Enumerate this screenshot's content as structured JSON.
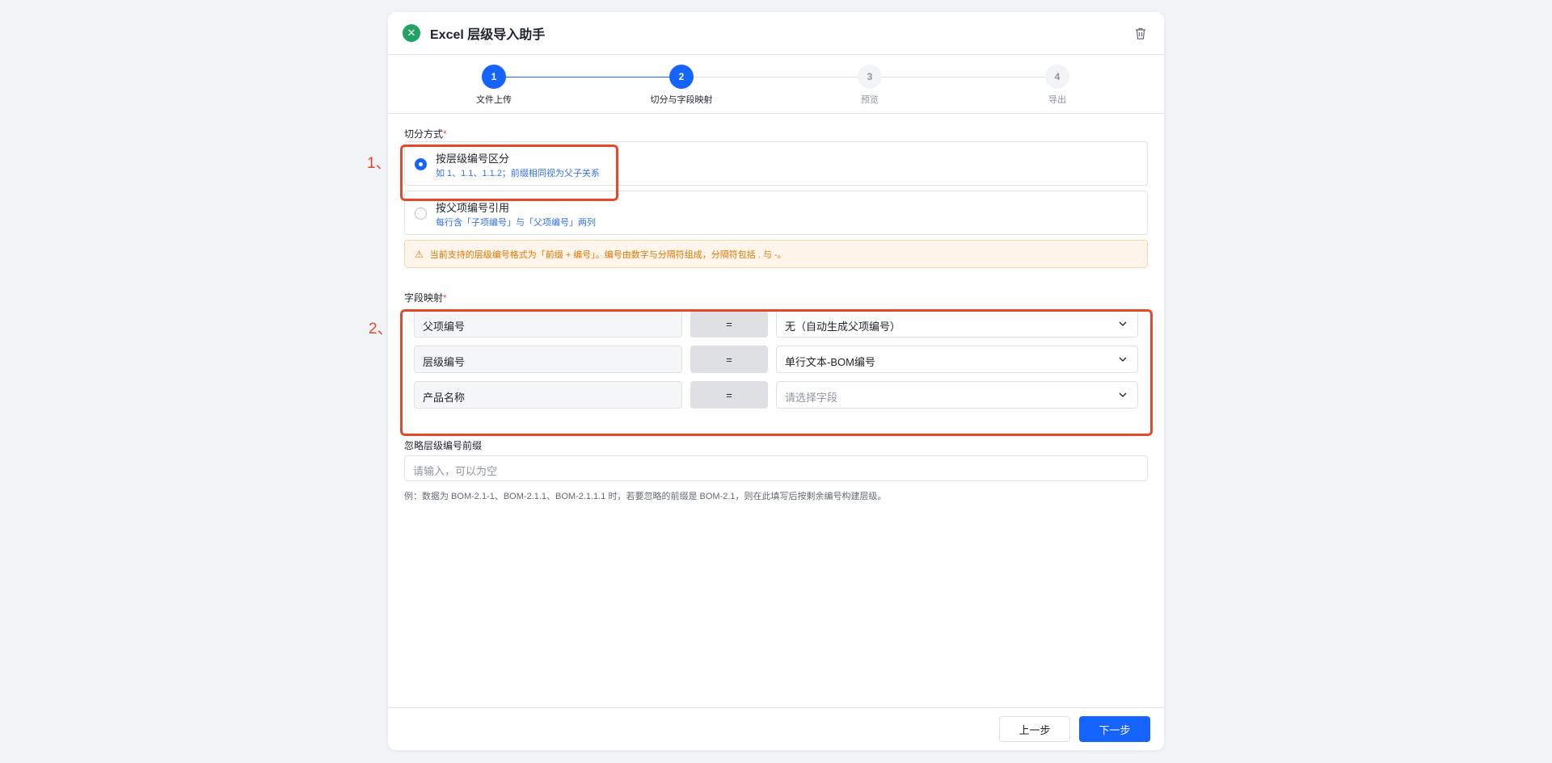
{
  "header": {
    "app_icon": "excel-icon",
    "title": "Excel 层级导入助手",
    "delete_icon": "trash-icon"
  },
  "steps": [
    {
      "number": "1",
      "label": "文件上传",
      "state": "done"
    },
    {
      "number": "2",
      "label": "切分与字段映射",
      "state": "active"
    },
    {
      "number": "3",
      "label": "预览",
      "state": "pending"
    },
    {
      "number": "4",
      "label": "导出",
      "state": "pending"
    }
  ],
  "split": {
    "label": "切分方式",
    "required_mark": "*",
    "options": [
      {
        "title": "按层级编号区分",
        "desc": "如 1、1.1、1.1.2；前缀相同视为父子关系",
        "checked": true
      },
      {
        "title": "按父项编号引用",
        "desc": "每行含「子项编号」与「父项编号」两列",
        "checked": false
      }
    ]
  },
  "warning": {
    "icon": "warning-icon",
    "text": "当前支持的层级编号格式为「前缀 + 编号」。编号由数字与分隔符组成，分隔符包括 . 与 -。"
  },
  "mapping": {
    "label": "字段映射",
    "required_mark": "*",
    "equals": "=",
    "rows": [
      {
        "field": "父项编号",
        "value": "无（自动生成父项编号）",
        "is_placeholder": false
      },
      {
        "field": "层级编号",
        "value": "单行文本-BOM编号",
        "is_placeholder": false
      },
      {
        "field": "产品名称",
        "value": "请选择字段",
        "is_placeholder": true
      }
    ]
  },
  "prefix": {
    "label": "忽略层级编号前缀",
    "placeholder": "请输入，可以为空",
    "hint": "例：数据为 BOM-2.1-1、BOM-2.1.1、BOM-2.1.1.1 时，若要忽略的前缀是 BOM-2.1，则在此填写后按剩余编号构建层级。"
  },
  "footer": {
    "prev": "上一步",
    "next": "下一步"
  },
  "annotations": {
    "one": "1、",
    "two": "2、"
  },
  "colors": {
    "primary": "#1664ff",
    "annotation": "#e8482a",
    "warning_text": "#de7802",
    "warning_bg": "#fff5eb"
  }
}
